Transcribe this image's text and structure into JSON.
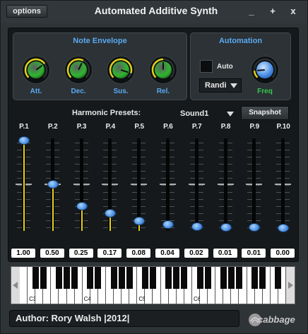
{
  "titlebar": {
    "options_label": "options",
    "title": "Automated Additive Synth",
    "minimize_label": "_",
    "maximize_label": "+",
    "close_label": "x"
  },
  "note_envelope": {
    "title": "Note Envelope",
    "knobs": [
      {
        "label": "Att.",
        "value": 0.7,
        "color": "#2fb52f"
      },
      {
        "label": "Dec.",
        "value": 0.6,
        "color": "#2fb52f"
      },
      {
        "label": "Sus.",
        "value": 0.9,
        "color": "#2fb52f"
      },
      {
        "label": "Rel.",
        "value": 0.5,
        "color": "#2fb52f"
      }
    ]
  },
  "automation": {
    "title": "Automation",
    "auto_label": "Auto",
    "auto_checked": false,
    "mode_value": "Randi",
    "freq_label": "Freq",
    "freq_value": 0.15,
    "freq_color": "#3f86e0"
  },
  "harmonic_presets": {
    "label": "Harmonic Presets:",
    "value": "Sound1",
    "snapshot_label": "Snapshot"
  },
  "partials": [
    {
      "label": "P.1",
      "value": 1.0,
      "display": "1.00"
    },
    {
      "label": "P.2",
      "value": 0.5,
      "display": "0.50"
    },
    {
      "label": "P.3",
      "value": 0.25,
      "display": "0.25"
    },
    {
      "label": "P.4",
      "value": 0.17,
      "display": "0.17"
    },
    {
      "label": "P.5",
      "value": 0.08,
      "display": "0.08"
    },
    {
      "label": "P.6",
      "value": 0.04,
      "display": "0.04"
    },
    {
      "label": "P.7",
      "value": 0.02,
      "display": "0.02"
    },
    {
      "label": "P.8",
      "value": 0.01,
      "display": "0.01"
    },
    {
      "label": "P.9",
      "value": 0.01,
      "display": "0.01"
    },
    {
      "label": "P.10",
      "value": 0.0,
      "display": "0.00"
    }
  ],
  "keyboard": {
    "octave_labels": [
      "C3",
      "C4",
      "C5",
      "C6"
    ]
  },
  "footer": {
    "author_text": "Author: Rory Walsh |2012|",
    "logo_text": "cabbage"
  }
}
